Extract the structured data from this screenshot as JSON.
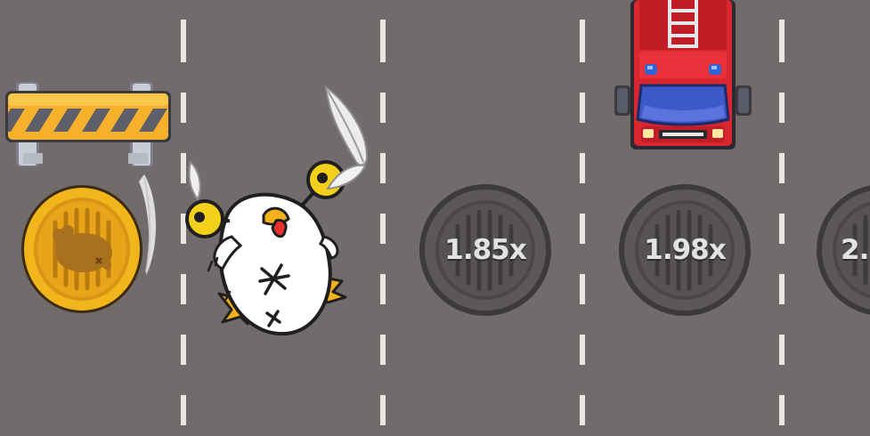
{
  "game": {
    "lanes": 4,
    "player_state": "hit"
  },
  "manholes": [
    {
      "multiplier": "1.85x"
    },
    {
      "multiplier": "1.98x"
    },
    {
      "multiplier": "2."
    }
  ],
  "colors": {
    "road": "#716c6b",
    "lane_line": "#e9e6e3",
    "coin_gold": "#f2b51c",
    "truck_red": "#d9262f",
    "manhole_gray": "#5b5857"
  },
  "icons": {
    "barrier": "road-barrier-icon",
    "coin": "gold-chicken-coin-icon",
    "truck": "fire-truck-icon",
    "chicken": "knocked-out-chicken-icon"
  }
}
